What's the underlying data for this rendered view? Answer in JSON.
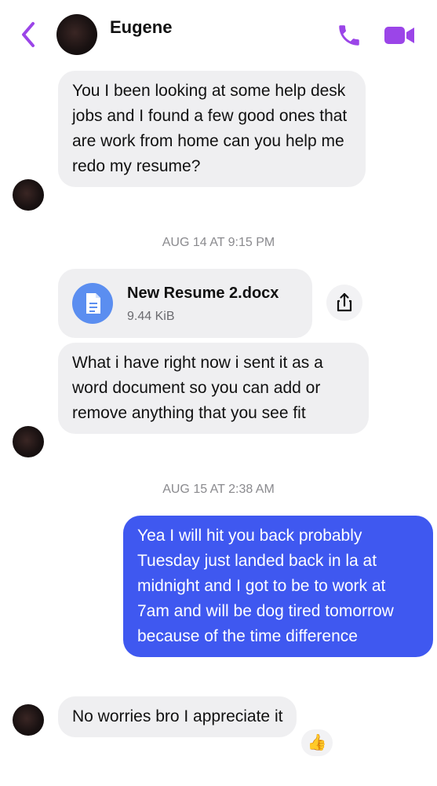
{
  "header": {
    "contact_name": "Eugene",
    "accent_color": "#9b45e8"
  },
  "messages": [
    {
      "text": "You I been looking at some help desk jobs and I found a few good ones that are work from home can you help me redo my resume?"
    },
    {
      "timestamp": "AUG 14 AT 9:15 PM"
    },
    {
      "file": {
        "name": "New Resume 2.docx",
        "size": "9.44 KiB"
      }
    },
    {
      "text": "What i have right now i sent it as a word document so you can add or remove anything that you see fit"
    },
    {
      "timestamp": "AUG 15 AT 2:38 AM"
    },
    {
      "text": "Yea I will hit you back probably Tuesday just landed back in la at midnight and I got to be to work at 7am and will be dog tired tomorrow because of the time difference"
    },
    {
      "text": "No worries bro I appreciate it",
      "reaction": "👍"
    }
  ],
  "colors": {
    "outgoing_bubble": "#3f58f0",
    "incoming_bubble": "#efeff1",
    "file_icon": "#5b8ef0"
  }
}
